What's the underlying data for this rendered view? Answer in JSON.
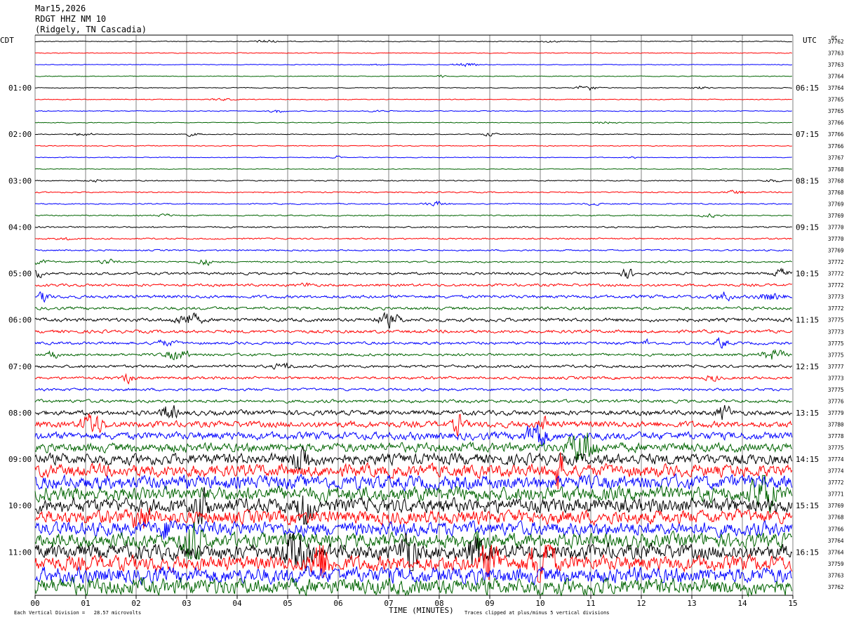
{
  "header": {
    "date": "Mar15,2026",
    "station": "RDGT HHZ NM 10",
    "location": "(Ridgely, TN Cascadia)"
  },
  "labels": {
    "left_tz": "CDT",
    "right_tz": "UTC",
    "dc": "DC",
    "x_axis_title": "TIME (MINUTES)",
    "footer_scale": "Each Vertical Division =   28.57 microvolts",
    "footer_clip": "Traces clipped at plus/minus 5 vertical divisions"
  },
  "colors": {
    "trace_cycle": [
      "#000000",
      "#ff0000",
      "#0000ff",
      "#006400"
    ],
    "grid": "#808080"
  },
  "chart_data": {
    "type": "line",
    "xlabel": "TIME (MINUTES)",
    "x_ticks": [
      "00",
      "01",
      "02",
      "03",
      "04",
      "05",
      "06",
      "07",
      "08",
      "09",
      "10",
      "11",
      "12",
      "13",
      "14",
      "15"
    ],
    "xlim": [
      0,
      15
    ],
    "rows_per_hour": 4,
    "left_hour_labels": [
      "01:00",
      "02:00",
      "03:00",
      "04:00",
      "05:00",
      "06:00",
      "07:00",
      "08:00",
      "09:00",
      "10:00",
      "11:00"
    ],
    "right_hour_labels": [
      "06:15",
      "07:15",
      "08:15",
      "09:15",
      "10:15",
      "11:15",
      "12:15",
      "13:15",
      "14:15",
      "15:15",
      "16:15"
    ],
    "dc_values": [
      "37762",
      "37763",
      "37763",
      "37764",
      "37764",
      "37765",
      "37765",
      "37766",
      "37766",
      "37766",
      "37767",
      "37768",
      "37768",
      "37768",
      "37769",
      "37769",
      "37770",
      "37770",
      "37769",
      "37772",
      "37772",
      "37772",
      "37773",
      "37772",
      "37775",
      "37773",
      "37775",
      "37775",
      "37777",
      "37773",
      "37775",
      "37776",
      "37779",
      "37780",
      "37778",
      "37775",
      "37774",
      "37774",
      "37772",
      "37771",
      "37769",
      "37768",
      "37766",
      "37764",
      "37764",
      "37759",
      "37763",
      "37762"
    ],
    "noise_level": [
      0.12,
      0.12,
      0.11,
      0.11,
      0.12,
      0.12,
      0.12,
      0.11,
      0.12,
      0.12,
      0.11,
      0.11,
      0.16,
      0.18,
      0.17,
      0.17,
      0.22,
      0.22,
      0.22,
      0.24,
      0.35,
      0.38,
      0.45,
      0.42,
      0.5,
      0.45,
      0.4,
      0.38,
      0.4,
      0.4,
      0.38,
      0.45,
      0.7,
      0.9,
      1.1,
      1.3,
      1.6,
      1.8,
      2.0,
      2.1,
      2.1,
      2.0,
      2.0,
      2.1,
      2.2,
      2.2,
      2.3,
      2.4
    ],
    "clip_divisions": 5
  }
}
